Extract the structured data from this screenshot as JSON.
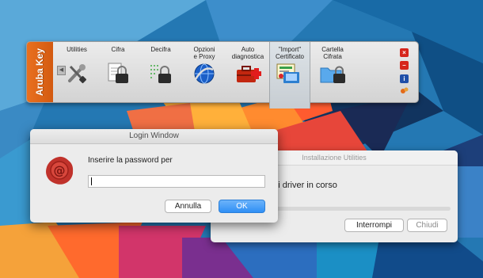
{
  "toolbar": {
    "brand": "Aruba Key",
    "collapse_glyph": "◀",
    "items": [
      {
        "id": "utilities",
        "label": "Utilities",
        "icon": "wrench-screwdriver-icon"
      },
      {
        "id": "cifra",
        "label": "Cifra",
        "icon": "encrypt-file-padlock-icon"
      },
      {
        "id": "decifra",
        "label": "Decifra",
        "icon": "decrypt-binary-padlock-icon"
      },
      {
        "id": "opzioni-proxy",
        "label": "Opzioni\ne Proxy",
        "icon": "globe-network-icon"
      },
      {
        "id": "autodiagnostica",
        "label": "Auto\ndiagnostica",
        "icon": "toolbox-plus-icon"
      },
      {
        "id": "import-certificato",
        "label": "\"Import\"\nCertificato",
        "icon": "certificate-import-icon"
      },
      {
        "id": "cartella-cifrata",
        "label": "Cartella\nCifrata",
        "icon": "folder-padlock-icon"
      }
    ],
    "window_controls": [
      "close-icon",
      "minimize-icon",
      "info-icon",
      "aruba-logo-icon"
    ]
  },
  "install_window": {
    "title": "Installazione Utilities",
    "status": "dei driver in corso",
    "progress": 0,
    "buttons": {
      "interrompi": "Interrompi",
      "chiudi": "Chiudi"
    }
  },
  "login_window": {
    "title": "Login Window",
    "prompt": "Inserire la password per",
    "password_value": "",
    "icon": "wax-seal-at-icon",
    "buttons": {
      "annulla": "Annulla",
      "ok": "OK"
    }
  },
  "colors": {
    "brand_orange": "#e36a1a",
    "ok_blue": "#2f8ff5",
    "close_red": "#d6261c",
    "info_blue": "#1f4fa8"
  }
}
